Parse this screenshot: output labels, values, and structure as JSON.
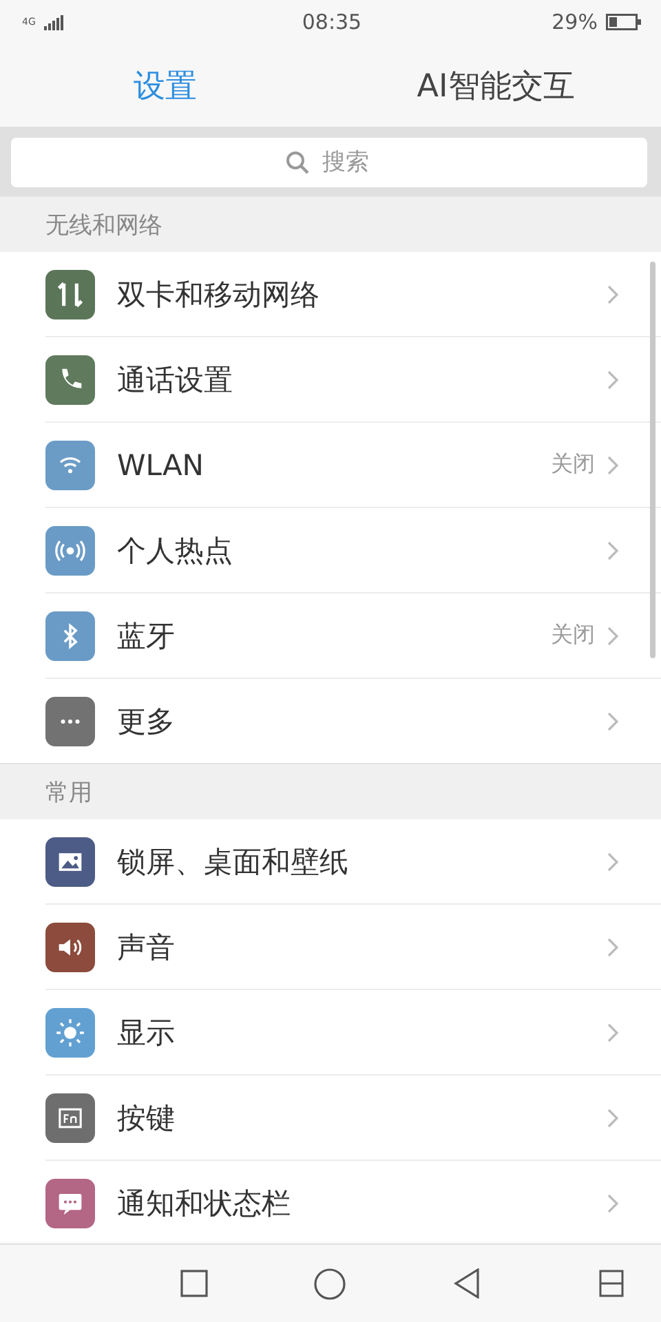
{
  "status_bar": {
    "time": "08:35",
    "network": "4G",
    "battery_percent": "29%"
  },
  "tabs": [
    {
      "label": "设置",
      "selected": true
    },
    {
      "label": "AI智能交互",
      "selected": false
    }
  ],
  "search": {
    "placeholder": "搜索"
  },
  "sections": [
    {
      "title": "无线和网络",
      "items": [
        {
          "label": "双卡和移动网络",
          "color": "#5b7558"
        },
        {
          "label": "通话设置",
          "color": "#5f7a5c"
        },
        {
          "label": "WLAN",
          "value": "关闭",
          "color": "#6b9cc6"
        },
        {
          "label": "个人热点",
          "color": "#6a9bc6"
        },
        {
          "label": "蓝牙",
          "value": "关闭",
          "color": "#6a9bc6"
        },
        {
          "label": "更多",
          "color": "#727272"
        }
      ]
    },
    {
      "title": "常用",
      "items": [
        {
          "label": "锁屏、桌面和壁纸",
          "color": "#4d5c86"
        },
        {
          "label": "声音",
          "color": "#8c4b3c"
        },
        {
          "label": "显示",
          "color": "#62a0d2"
        },
        {
          "label": "按键",
          "color": "#6e6e6e"
        },
        {
          "label": "通知和状态栏",
          "color": "#b46685"
        }
      ]
    }
  ]
}
